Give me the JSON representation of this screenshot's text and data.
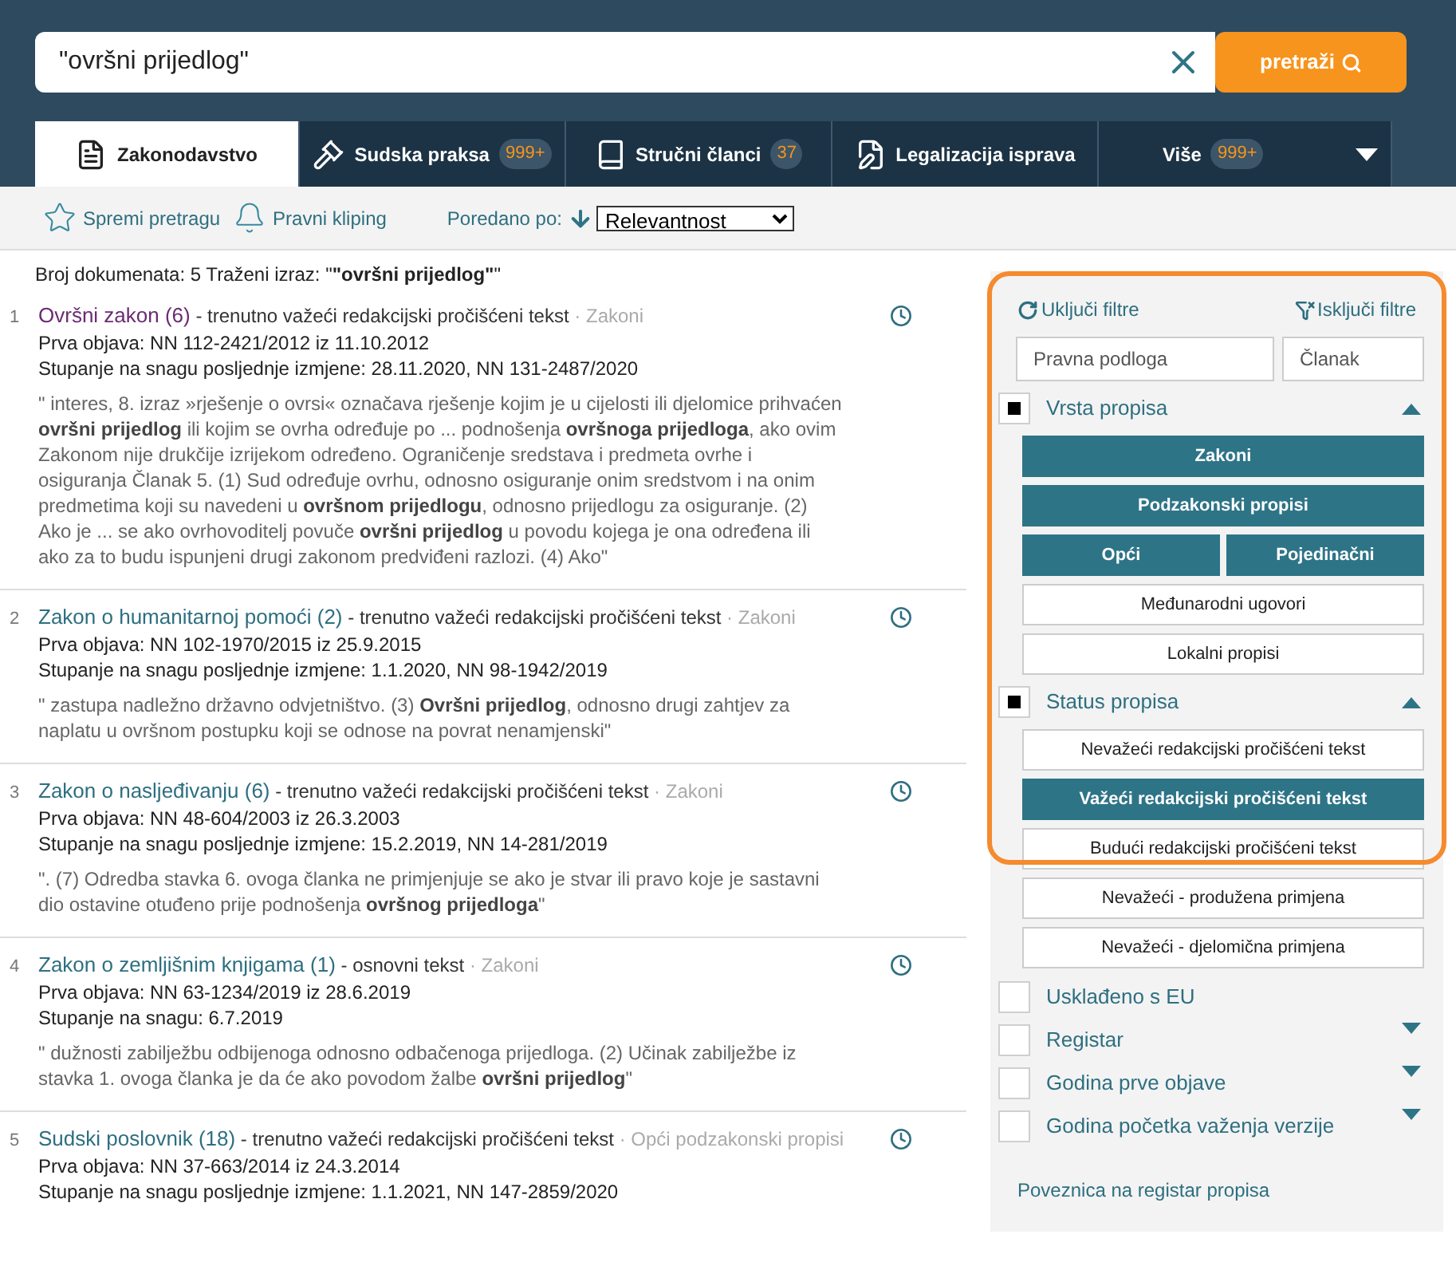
{
  "search": {
    "value": "\"ovršni prijedlog\"",
    "button": "pretraži"
  },
  "tabs": [
    {
      "kind": "law",
      "label": "Zakonodavstvo",
      "selected": true
    },
    {
      "kind": "court",
      "label": "Sudska praksa",
      "badge": "999+",
      "selected": false
    },
    {
      "kind": "book",
      "label": "Stručni članci",
      "badge": "37",
      "selected": false
    },
    {
      "kind": "form",
      "label": "Legalizacija isprava",
      "selected": false
    },
    {
      "kind": "more",
      "label": "Više",
      "badge": "999+",
      "selected": false
    }
  ],
  "toolbar": {
    "save": "Spremi pretragu",
    "clipping": "Pravni kliping",
    "sort_label": "Poredano po:",
    "sort_value": "Relevantnost"
  },
  "summary": "Broj dokumenata: 5 Traženi izraz: \"**\"ovršni prijedlog\"**\"",
  "results": [
    {
      "number": "1",
      "title": "Ovršni zakon (6)",
      "visited": true,
      "version": "- trenutno važeći redakcijski pročišćeni tekst",
      "category": "· Zakoni",
      "lines": [
        "Prva objava: NN 112-2421/2012 iz 11.10.2012",
        "Stupanje na snagu posljednje izmjene: 28.11.2020, NN 131-2487/2020"
      ],
      "snippet": "\" interes, 8. izraz »rješenje o ovrsi« označava rješenje kojim je u cijelosti ili djelomice prihvaćen **ovršni prijedlog** ili kojim se ovrha određuje po ... podnošenja **ovršnoga prijedloga**, ako ovim Zakonom nije drukčije izrijekom određeno. Ograničenje sredstava i predmeta ovrhe i osiguranja Članak 5. (1) Sud određuje ovrhu, odnosno osiguranje onim sredstvom i na onim predmetima koji su navedeni u **ovršnom prijedlogu**, odnosno prijedlogu za osiguranje. (2) Ako je ... se ako ovrhovoditelj povuče **ovršni prijedlog** u povodu kojega je ona određena ili ako za to budu ispunjeni drugi zakonom predviđeni razlozi. (4) Ako\""
    },
    {
      "number": "2",
      "title": "Zakon o humanitarnoj pomoći (2)",
      "visited": false,
      "version": "- trenutno važeći redakcijski pročišćeni tekst",
      "category": "· Zakoni",
      "lines": [
        "Prva objava: NN 102-1970/2015 iz 25.9.2015",
        "Stupanje na snagu posljednje izmjene: 1.1.2020, NN 98-1942/2019"
      ],
      "snippet": "\" zastupa nadležno državno odvjetništvo. (3) **Ovršni prijedlog**, odnosno drugi zahtjev za naplatu u ovršnom postupku koji se odnose na povrat nenamjenski\""
    },
    {
      "number": "3",
      "title": "Zakon o nasljeđivanju (6)",
      "visited": false,
      "version": "- trenutno važeći redakcijski pročišćeni tekst",
      "category": "· Zakoni",
      "lines": [
        "Prva objava: NN 48-604/2003 iz 26.3.2003",
        "Stupanje na snagu posljednje izmjene: 15.2.2019, NN 14-281/2019"
      ],
      "snippet": "\". (7) Odredba stavka 6. ovoga članka ne primjenjuje se ako je stvar ili pravo koje je sastavni dio ostavine otuđeno prije podnošenja **ovršnog prijedloga**\""
    },
    {
      "number": "4",
      "title": "Zakon o zemljišnim knjigama (1)",
      "visited": false,
      "version": "- osnovni tekst",
      "category": "· Zakoni",
      "lines": [
        "Prva objava: NN 63-1234/2019 iz 28.6.2019",
        "Stupanje na snagu: 6.7.2019"
      ],
      "snippet": "\" dužnosti zabilježbu odbijenoga odnosno odbačenoga prijedloga. (2) Učinak zabilježbe iz stavka 1. ovoga članka je da će ako povodom žalbe **ovršni prijedlog**\""
    },
    {
      "number": "5",
      "title": "Sudski poslovnik (18)",
      "visited": false,
      "version": "- trenutno važeći redakcijski pročišćeni tekst",
      "category": "· Opći podzakonski propisi",
      "lines": [
        "Prva objava: NN 37-663/2014 iz 24.3.2014",
        "Stupanje na snagu posljednje izmjene: 1.1.2021, NN 147-2859/2020"
      ]
    }
  ],
  "filters": {
    "enable": "Uključi filtre",
    "disable": "Isključi filtre",
    "basis_placeholder": "Pravna podloga",
    "article_placeholder": "Članak",
    "groups": [
      {
        "title": "Vrsta propisa",
        "checked": true,
        "expanded": true,
        "options": [
          [
            {
              "label": "Zakoni",
              "selected": true
            }
          ],
          [
            {
              "label": "Podzakonski propisi",
              "selected": true
            }
          ],
          [
            {
              "label": "Opći",
              "selected": true
            },
            {
              "label": "Pojedinačni",
              "selected": true
            }
          ],
          [
            {
              "label": "Međunarodni ugovori",
              "selected": false
            }
          ],
          [
            {
              "label": "Lokalni propisi",
              "selected": false
            }
          ]
        ]
      },
      {
        "title": "Status propisa",
        "checked": true,
        "expanded": true,
        "options": [
          [
            {
              "label": "Nevažeći redakcijski pročišćeni tekst",
              "selected": false
            }
          ],
          [
            {
              "label": "Važeći redakcijski pročišćeni tekst",
              "selected": true
            }
          ],
          [
            {
              "label": "Budući redakcijski pročišćeni tekst",
              "selected": false
            }
          ],
          [
            {
              "label": "Nevažeći - produžena primjena",
              "selected": false
            }
          ],
          [
            {
              "label": "Nevažeći - djelomična primjena",
              "selected": false
            }
          ]
        ]
      }
    ],
    "extra": [
      {
        "kind": "plain",
        "title": "Usklađeno s EU",
        "checked": false
      },
      {
        "kind": "collapsible",
        "title": "Registar",
        "checked": false,
        "expanded": false
      },
      {
        "kind": "collapsible",
        "title": "Godina prve objave",
        "checked": false,
        "expanded": false
      },
      {
        "kind": "collapsible",
        "title": "Godina početka važenja verzije",
        "checked": false,
        "expanded": false
      }
    ],
    "link": "Poveznica na registar propisa"
  }
}
